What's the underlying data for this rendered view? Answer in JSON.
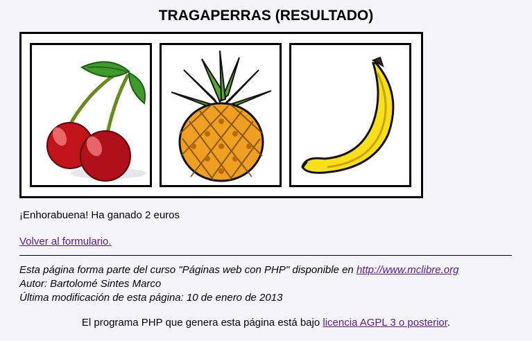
{
  "page": {
    "title": "TRAGAPERRAS (RESULTADO)"
  },
  "reels": [
    {
      "fruit": "cherries",
      "icon": "cherries-icon"
    },
    {
      "fruit": "pineapple",
      "icon": "pineapple-icon"
    },
    {
      "fruit": "banana",
      "icon": "banana-icon"
    }
  ],
  "result": {
    "message": "¡Enhorabuena! Ha ganado 2 euros"
  },
  "links": {
    "back": "Volver al formulario."
  },
  "footer": {
    "course_prefix": "Esta página forma parte del curso \"Páginas web con PHP\" disponible en ",
    "course_link": "http://www.mclibre.org",
    "author": "Autor: Bartolomé Sintes Marco",
    "modified": "Última modificación de esta página: 10 de enero de 2013",
    "license_prefix": "El programa PHP que genera esta página está bajo ",
    "license_link": "licencia AGPL 3 o posterior",
    "license_suffix": "."
  },
  "colors": {
    "background": "#f4f4fa",
    "link": "#551a8b",
    "cherry_red": "#c0141a",
    "leaf_green": "#3f9a2c",
    "pineapple_orange": "#f0a020",
    "banana_yellow": "#f8df1c"
  }
}
